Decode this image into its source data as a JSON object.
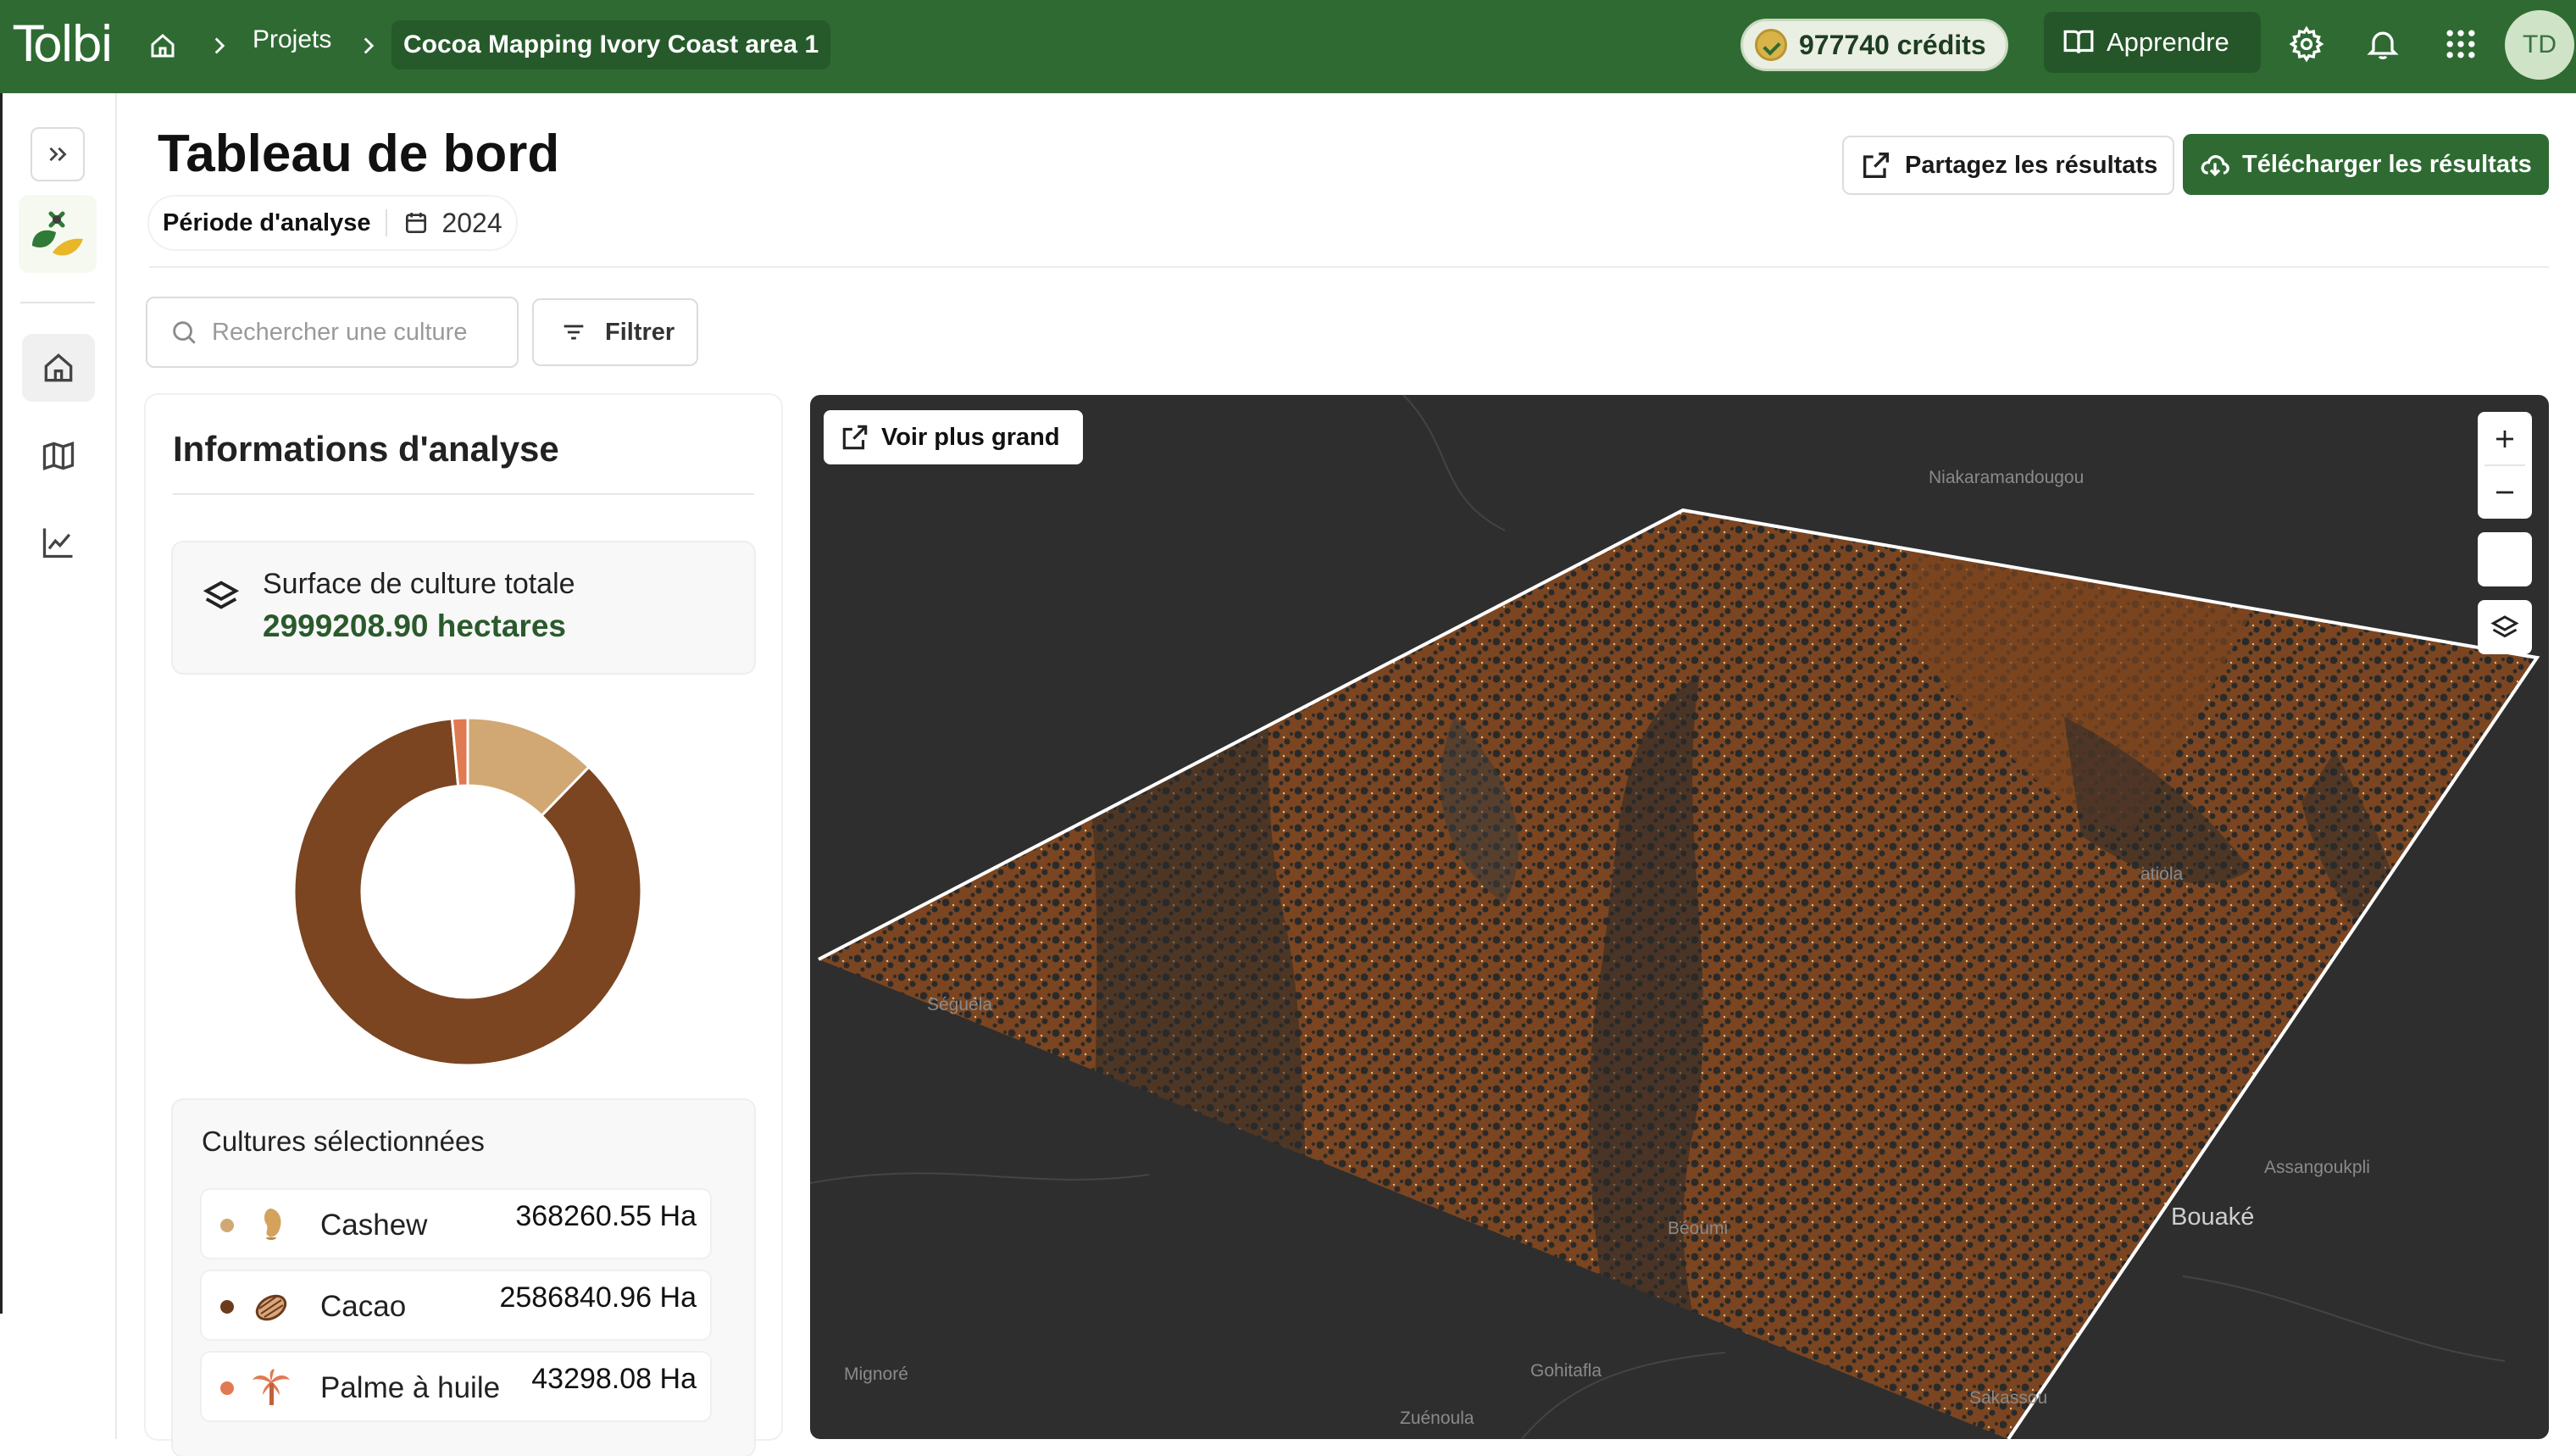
{
  "app": {
    "logo": "Tolbi"
  },
  "breadcrumb": {
    "projects": "Projets",
    "current": "Cocoa Mapping Ivory Coast area 1"
  },
  "topbar": {
    "credits": "977740 crédits",
    "learn": "Apprendre",
    "avatar": "TD"
  },
  "header": {
    "title": "Tableau de bord",
    "period_label": "Période d'analyse",
    "period_value": "2024",
    "share": "Partagez les résultats",
    "download": "Télécharger les résultats"
  },
  "search": {
    "placeholder": "Rechercher une culture",
    "value": ""
  },
  "filter": {
    "label": "Filtrer"
  },
  "info": {
    "title": "Informations d'analyse",
    "surface_label": "Surface de culture totale",
    "surface_value": "2999208.90 hectares"
  },
  "donut": {
    "segments": [
      {
        "crop": "Cashew",
        "hectares": 368260.55,
        "color": "#d1a874"
      },
      {
        "crop": "Cacao",
        "hectares": 2586840.96,
        "color": "#7a4520"
      },
      {
        "crop": "Palme à huile",
        "hectares": 43298.08,
        "color": "#e07a52"
      }
    ]
  },
  "crops": {
    "title": "Cultures sélectionnées",
    "items": [
      {
        "name": "Cashew",
        "area": "368260.55 Ha",
        "dot": "#d1a874",
        "icon": "cashew-icon"
      },
      {
        "name": "Cacao",
        "area": "2586840.96 Ha",
        "dot": "#6b3b1c",
        "icon": "cacao-icon"
      },
      {
        "name": "Palme à huile",
        "area": "43298.08 Ha",
        "dot": "#e07a52",
        "icon": "palm-icon"
      }
    ]
  },
  "map": {
    "expand": "Voir plus grand",
    "places": {
      "niakaramandougou": "Niakaramandougou",
      "seguela": "Séguéla",
      "bouake": "Bouaké",
      "assangoukpli": "Assangoukpli",
      "mignore": "Mignoré",
      "gohitafla": "Gohitafla",
      "zuenoula": "Zuénoula",
      "sakassou": "Sakassou",
      "beoumi": "Béoumi",
      "katiola": "atiola"
    },
    "colors": {
      "background": "#2e2e2e",
      "cacao": "#7a4520",
      "outline": "#ffffff"
    }
  }
}
